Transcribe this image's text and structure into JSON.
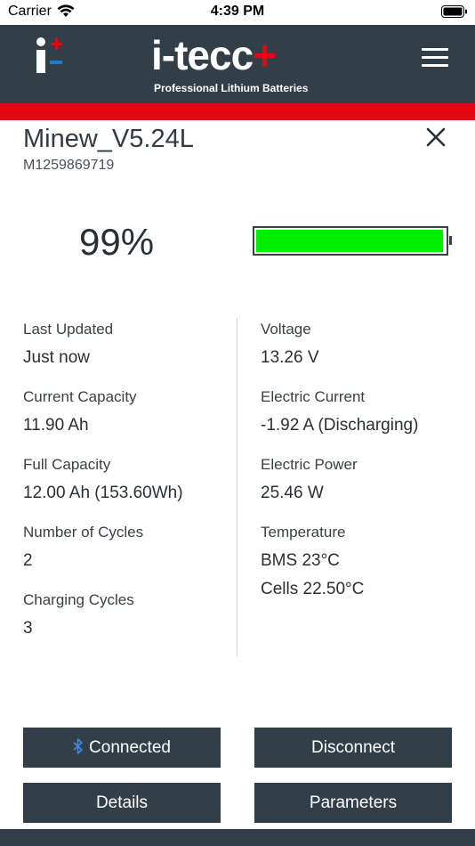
{
  "status_bar": {
    "carrier": "Carrier",
    "time": "4:39 PM"
  },
  "header": {
    "logo_text": "i-tecc",
    "logo_plus": "+",
    "tagline": "Professional Lithium Batteries"
  },
  "device": {
    "name": "Minew_V5.24L",
    "id": "M1259869719"
  },
  "battery": {
    "percent_label": "99%",
    "level": 0.99,
    "fill_color": "#00ee00"
  },
  "left_stats": [
    {
      "label": "Last Updated",
      "value": "Just now"
    },
    {
      "label": "Current Capacity",
      "value": "11.90 Ah"
    },
    {
      "label": "Full Capacity",
      "value": "12.00 Ah (153.60Wh)"
    },
    {
      "label": "Number of Cycles",
      "value": "2"
    },
    {
      "label": "Charging Cycles",
      "value": "3"
    }
  ],
  "right_stats": [
    {
      "label": "Voltage",
      "value": "13.26 V"
    },
    {
      "label": "Electric Current",
      "value": "-1.92 A (Discharging)"
    },
    {
      "label": "Electric Power",
      "value": "25.46 W"
    },
    {
      "label": "Temperature",
      "value": "BMS 23°C",
      "value2": "Cells 22.50°C"
    }
  ],
  "buttons": {
    "connected": "Connected",
    "disconnect": "Disconnect",
    "details": "Details",
    "parameters": "Parameters"
  },
  "colors": {
    "header_bg": "#323f48",
    "accent_red": "#e30613",
    "bluetooth_blue": "#3a8ee6"
  }
}
